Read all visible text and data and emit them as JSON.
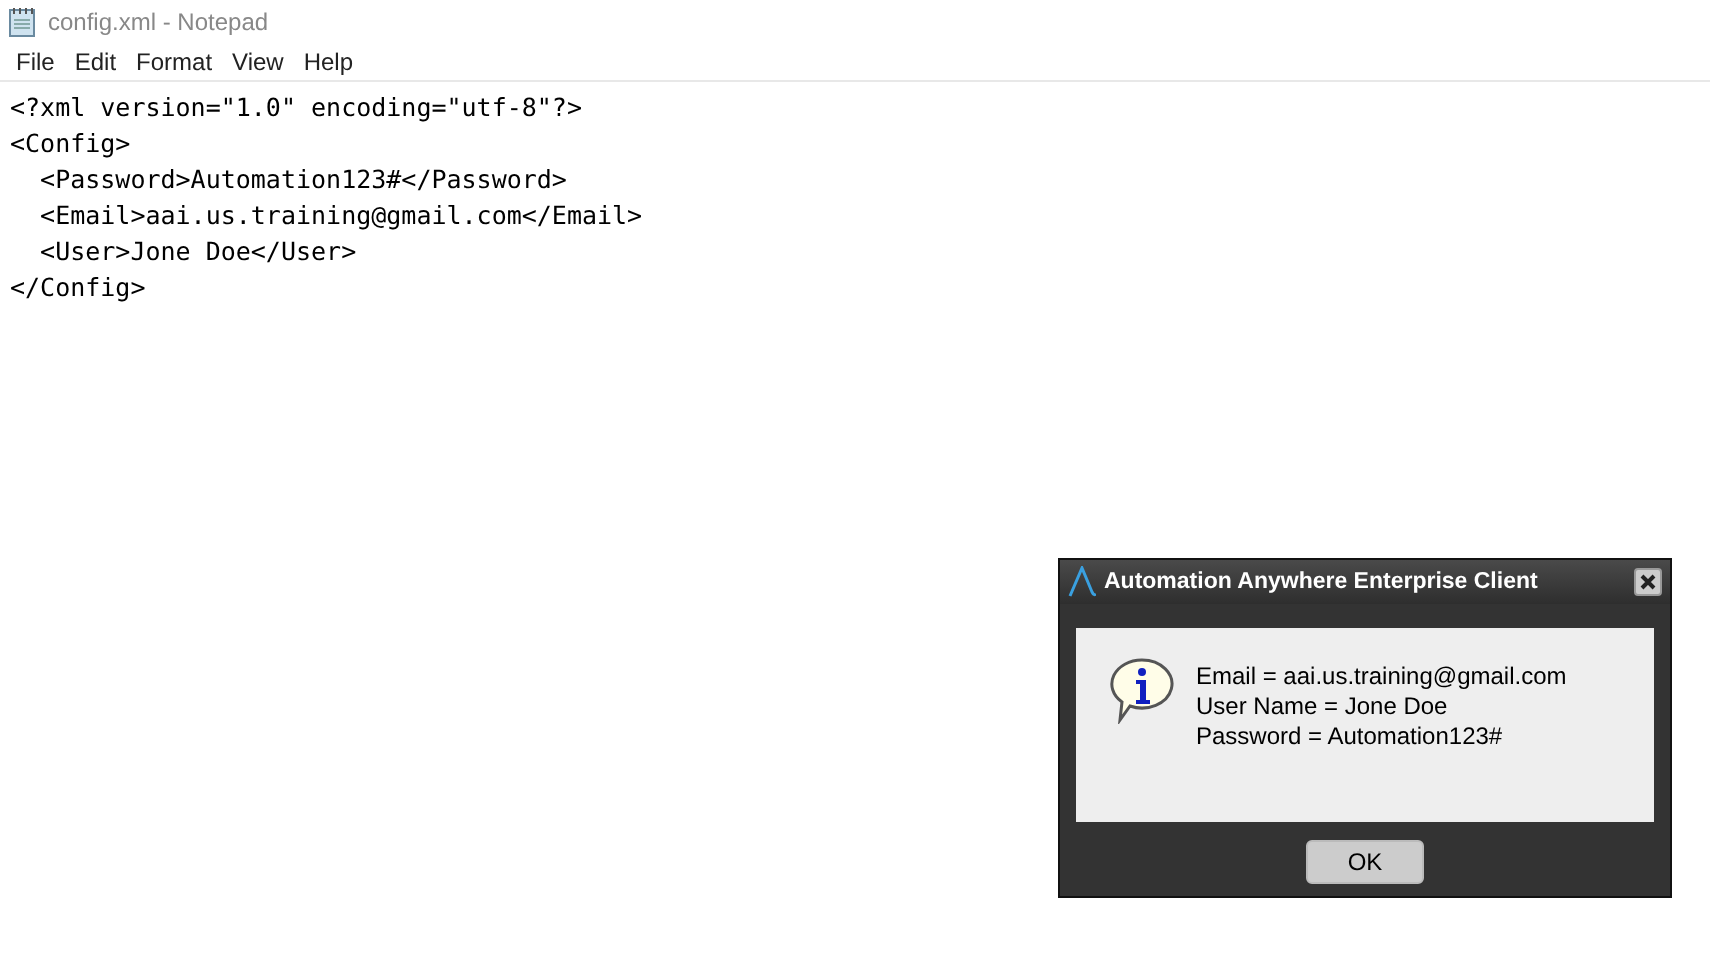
{
  "window": {
    "title": "config.xml - Notepad"
  },
  "menu": [
    "File",
    "Edit",
    "Format",
    "View",
    "Help"
  ],
  "editor": {
    "lines": [
      "<?xml version=\"1.0\" encoding=\"utf-8\"?>",
      "<Config>",
      "  <Password>Automation123#</Password>",
      "  <Email>aai.us.training@gmail.com</Email>",
      "  <User>Jone Doe</User>",
      "</Config>"
    ]
  },
  "dialog": {
    "title": "Automation Anywhere Enterprise Client",
    "message": [
      "Email = aai.us.training@gmail.com",
      "User Name = Jone Doe",
      "Password = Automation123#"
    ],
    "buttons": [
      "OK"
    ]
  }
}
